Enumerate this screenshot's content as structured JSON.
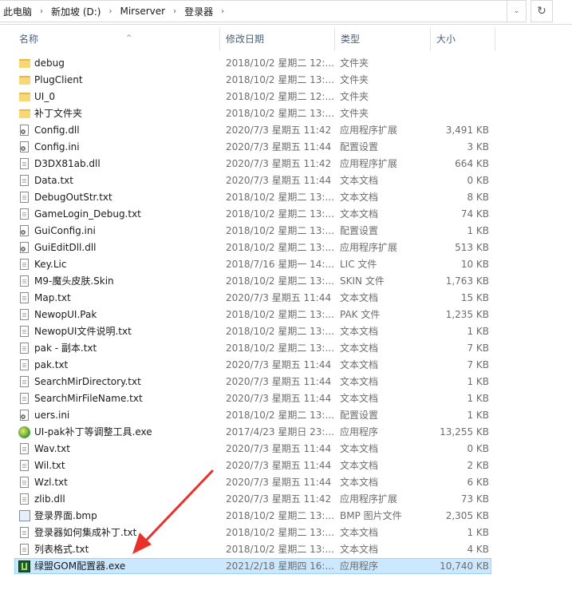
{
  "addressbar": {
    "crumbs": [
      "此电脑",
      "新加坡 (D:)",
      "Mirserver",
      "登录器"
    ],
    "separator": "›",
    "dropdown_glyph": "⌄",
    "refresh_glyph": "↻"
  },
  "columns": {
    "name": "名称",
    "date": "修改日期",
    "type": "类型",
    "size": "大小",
    "sort_glyph": "^"
  },
  "files": [
    {
      "name": "debug",
      "date": "2018/10/2 星期二 12:...",
      "type": "文件夹",
      "size": "",
      "icon": "folder-icon"
    },
    {
      "name": "PlugClient",
      "date": "2018/10/2 星期二 13:...",
      "type": "文件夹",
      "size": "",
      "icon": "folder-icon"
    },
    {
      "name": "UI_0",
      "date": "2018/10/2 星期二 12:...",
      "type": "文件夹",
      "size": "",
      "icon": "folder-icon"
    },
    {
      "name": "补丁文件夹",
      "date": "2018/10/2 星期二 13:...",
      "type": "文件夹",
      "size": "",
      "icon": "folder-icon"
    },
    {
      "name": "Config.dll",
      "date": "2020/7/3 星期五 11:42",
      "type": "应用程序扩展",
      "size": "3,491 KB",
      "icon": "gear-file-icon"
    },
    {
      "name": "Config.ini",
      "date": "2020/7/3 星期五 11:44",
      "type": "配置设置",
      "size": "3 KB",
      "icon": "gear-file-icon"
    },
    {
      "name": "D3DX81ab.dll",
      "date": "2020/7/3 星期五 11:42",
      "type": "应用程序扩展",
      "size": "664 KB",
      "icon": "file-icon"
    },
    {
      "name": "Data.txt",
      "date": "2020/7/3 星期五 11:44",
      "type": "文本文档",
      "size": "0 KB",
      "icon": "file-icon"
    },
    {
      "name": "DebugOutStr.txt",
      "date": "2018/10/2 星期二 13:...",
      "type": "文本文档",
      "size": "8 KB",
      "icon": "file-icon"
    },
    {
      "name": "GameLogin_Debug.txt",
      "date": "2018/10/2 星期二 13:...",
      "type": "文本文档",
      "size": "74 KB",
      "icon": "file-icon"
    },
    {
      "name": "GuiConfig.ini",
      "date": "2018/10/2 星期二 13:...",
      "type": "配置设置",
      "size": "1 KB",
      "icon": "gear-file-icon"
    },
    {
      "name": "GuiEditDll.dll",
      "date": "2018/10/2 星期二 13:...",
      "type": "应用程序扩展",
      "size": "513 KB",
      "icon": "gear-file-icon"
    },
    {
      "name": "Key.Lic",
      "date": "2018/7/16 星期一 14:...",
      "type": "LIC 文件",
      "size": "10 KB",
      "icon": "file-icon"
    },
    {
      "name": "M9-魔头皮肤.Skin",
      "date": "2018/10/2 星期二 13:...",
      "type": "SKIN 文件",
      "size": "1,763 KB",
      "icon": "file-icon"
    },
    {
      "name": "Map.txt",
      "date": "2020/7/3 星期五 11:44",
      "type": "文本文档",
      "size": "15 KB",
      "icon": "file-icon"
    },
    {
      "name": "NewopUI.Pak",
      "date": "2018/10/2 星期二 13:...",
      "type": "PAK 文件",
      "size": "1,235 KB",
      "icon": "file-icon"
    },
    {
      "name": "NewopUI文件说明.txt",
      "date": "2018/10/2 星期二 13:...",
      "type": "文本文档",
      "size": "1 KB",
      "icon": "file-icon"
    },
    {
      "name": "pak - 副本.txt",
      "date": "2018/10/2 星期二 13:...",
      "type": "文本文档",
      "size": "7 KB",
      "icon": "file-icon"
    },
    {
      "name": "pak.txt",
      "date": "2020/7/3 星期五 11:44",
      "type": "文本文档",
      "size": "7 KB",
      "icon": "file-icon"
    },
    {
      "name": "SearchMirDirectory.txt",
      "date": "2020/7/3 星期五 11:44",
      "type": "文本文档",
      "size": "1 KB",
      "icon": "file-icon"
    },
    {
      "name": "SearchMirFileName.txt",
      "date": "2020/7/3 星期五 11:44",
      "type": "文本文档",
      "size": "1 KB",
      "icon": "file-icon"
    },
    {
      "name": "uers.ini",
      "date": "2018/10/2 星期二 13:...",
      "type": "配置设置",
      "size": "1 KB",
      "icon": "gear-file-icon"
    },
    {
      "name": "UI-pak补丁等调整工具.exe",
      "date": "2017/4/23 星期日 23:...",
      "type": "应用程序",
      "size": "13,255 KB",
      "icon": "exe-icon"
    },
    {
      "name": "Wav.txt",
      "date": "2020/7/3 星期五 11:44",
      "type": "文本文档",
      "size": "0 KB",
      "icon": "file-icon"
    },
    {
      "name": "Wil.txt",
      "date": "2020/7/3 星期五 11:44",
      "type": "文本文档",
      "size": "2 KB",
      "icon": "file-icon"
    },
    {
      "name": "Wzl.txt",
      "date": "2020/7/3 星期五 11:44",
      "type": "文本文档",
      "size": "6 KB",
      "icon": "file-icon"
    },
    {
      "name": "zlib.dll",
      "date": "2020/7/3 星期五 11:42",
      "type": "应用程序扩展",
      "size": "73 KB",
      "icon": "file-icon"
    },
    {
      "name": "登录界面.bmp",
      "date": "2018/10/2 星期二 13:...",
      "type": "BMP 图片文件",
      "size": "2,305 KB",
      "icon": "bmp-icon"
    },
    {
      "name": "登录器如何集成补丁.txt",
      "date": "2018/10/2 星期二 13:...",
      "type": "文本文档",
      "size": "1 KB",
      "icon": "file-icon"
    },
    {
      "name": "列表格式.txt",
      "date": "2018/10/2 星期二 13:...",
      "type": "文本文档",
      "size": "4 KB",
      "icon": "file-icon"
    },
    {
      "name": "绿盟GOM配置器.exe",
      "date": "2021/2/18 星期四 16:...",
      "type": "应用程序",
      "size": "10,740 KB",
      "icon": "gom-exe-icon",
      "selected": true
    }
  ],
  "colors": {
    "selection_bg": "#cce8ff",
    "selection_border": "#99d1ff",
    "annotation_arrow": "#e8312a"
  }
}
